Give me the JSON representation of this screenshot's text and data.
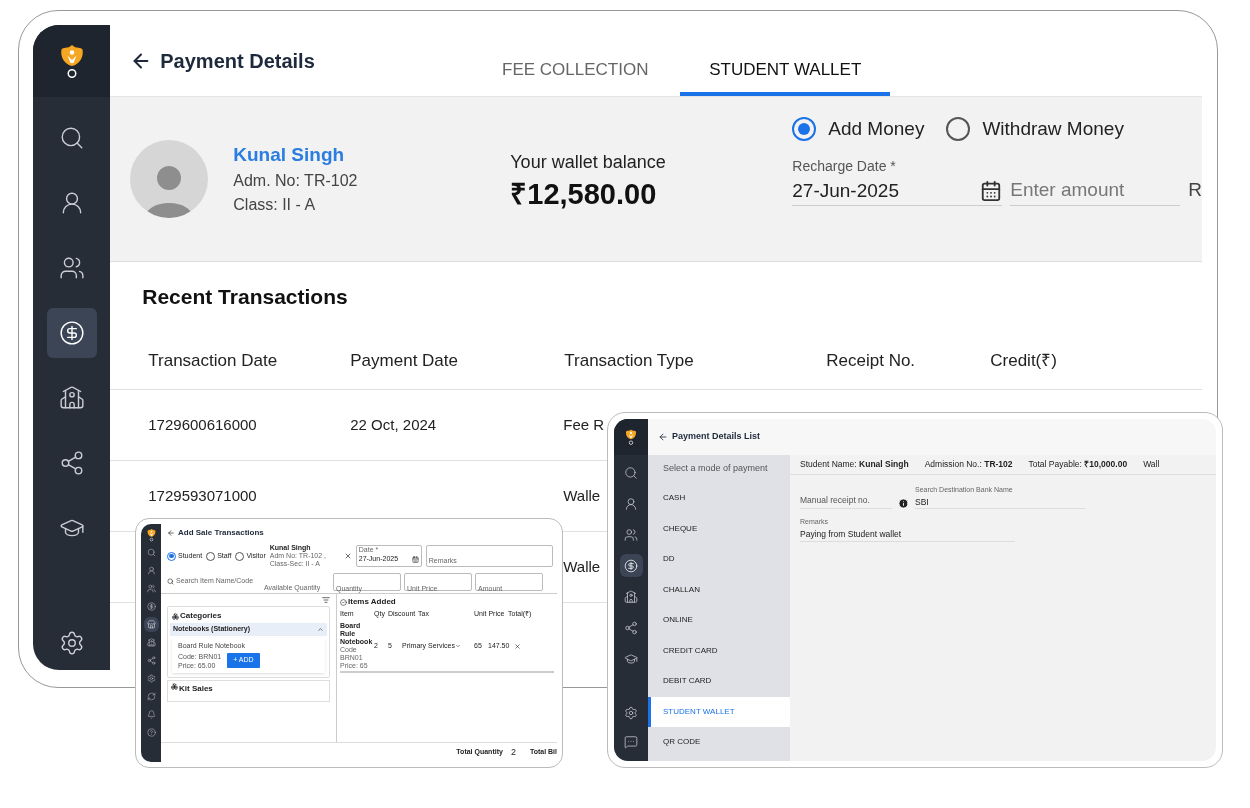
{
  "main": {
    "sidebar": {
      "items": [
        {
          "kind": "search",
          "selected": false
        },
        {
          "kind": "student",
          "selected": false
        },
        {
          "kind": "users",
          "selected": false
        },
        {
          "kind": "fees",
          "selected": true
        },
        {
          "kind": "school",
          "selected": false
        },
        {
          "kind": "network",
          "selected": false
        },
        {
          "kind": "academics",
          "selected": false
        },
        {
          "kind": "settings",
          "selected": false
        }
      ]
    },
    "title": "Payment Details",
    "tabs": [
      {
        "label": "FEE COLLECTION",
        "selected": false
      },
      {
        "label": "STUDENT WALLET",
        "selected": true
      }
    ],
    "student": {
      "name": "Kunal Singh",
      "admission": "Adm. No: TR-102",
      "class": "Class: II - A"
    },
    "wallet": {
      "label": "Your wallet balance",
      "amount": "₹12,580.00"
    },
    "modes": [
      {
        "label": "Add Money",
        "selected": true
      },
      {
        "label": "Withdraw Money",
        "selected": false
      }
    ],
    "recharge_date": {
      "label": "Recharge Date *",
      "value": "27-Jun-2025"
    },
    "amount": {
      "placeholder": "Enter amount"
    },
    "field_3": {
      "value": "R"
    },
    "transactions": {
      "title": "Recent Transactions",
      "columns": [
        "Transaction Date",
        "Payment Date",
        "Transaction Type",
        "Receipt No.",
        "Credit(₹)"
      ],
      "rows": [
        {
          "transaction_date": "1729600616000",
          "payment_date": "22 Oct, 2024",
          "transaction_type": "Fee R"
        },
        {
          "transaction_date": "1729593071000",
          "transaction_type": "Walle"
        },
        {
          "transaction_type": "Walle"
        }
      ]
    }
  },
  "sale_window": {
    "sidebar": {
      "items": [
        {
          "kind": "search",
          "selected": false
        },
        {
          "kind": "student",
          "selected": false
        },
        {
          "kind": "users",
          "selected": false
        },
        {
          "kind": "fees",
          "selected": false
        },
        {
          "kind": "store",
          "selected": true
        },
        {
          "kind": "school",
          "selected": false
        },
        {
          "kind": "network",
          "selected": false
        },
        {
          "kind": "settings",
          "selected": false
        },
        {
          "kind": "refresh",
          "selected": false
        },
        {
          "kind": "notifications",
          "selected": false
        },
        {
          "kind": "help",
          "selected": false
        }
      ]
    },
    "title": "Add Sale Transactions",
    "buyer_types": [
      {
        "label": "Student",
        "selected": true
      },
      {
        "label": "Staff",
        "selected": false
      },
      {
        "label": "Visitor",
        "selected": false
      }
    ],
    "buyer": {
      "name": "Kunal Singh",
      "details": "Adm No: TR-102 , Class-Sec: II - A"
    },
    "date": {
      "label": "Date *",
      "value": "27-Jun-2025"
    },
    "remarks": {
      "label": "Remarks"
    },
    "search": {
      "placeholder": "Search Item Name/Code"
    },
    "fields": [
      "Available Quantity",
      "Quantity",
      "Unit Price",
      "Amount"
    ],
    "categories": {
      "title": "Categories",
      "group": "Notebooks (Stationery)",
      "item": {
        "name": "Board Rule Notebook",
        "code": "Code: BRN01",
        "price": "Price: 65.00",
        "button": "+ ADD"
      }
    },
    "kit_sales": "Kit Sales",
    "items_added": {
      "title": "Items Added",
      "columns": [
        "Item",
        "Qty",
        "Discount",
        "Tax",
        "Unit Price",
        "Total(₹)"
      ],
      "rows": [
        {
          "item": "Board Rule Notebook",
          "code": "Code BRN01",
          "price": "Price: 65",
          "qty": "2",
          "discount": "5",
          "tax": "Primary Services",
          "unit_price": "65",
          "total": "147.50"
        }
      ]
    },
    "footer": {
      "quantity_label": "Total Quantity",
      "quantity": "2",
      "bill_label": "Total Bil"
    }
  },
  "payment_window": {
    "sidebar": {
      "items": [
        {
          "kind": "search",
          "selected": false
        },
        {
          "kind": "student",
          "selected": false
        },
        {
          "kind": "users",
          "selected": false
        },
        {
          "kind": "fees",
          "selected": true
        },
        {
          "kind": "school",
          "selected": false
        },
        {
          "kind": "network",
          "selected": false
        },
        {
          "kind": "academics",
          "selected": false
        },
        {
          "kind": "settings",
          "selected": false
        },
        {
          "kind": "chat",
          "selected": false
        }
      ]
    },
    "title": "Payment Details List",
    "modes_label": "Select a mode of payment",
    "modes": [
      {
        "label": "CASH",
        "selected": false
      },
      {
        "label": "CHEQUE",
        "selected": false
      },
      {
        "label": "DD",
        "selected": false
      },
      {
        "label": "CHALLAN",
        "selected": false
      },
      {
        "label": "ONLINE",
        "selected": false
      },
      {
        "label": "CREDIT CARD",
        "selected": false
      },
      {
        "label": "DEBIT CARD",
        "selected": false
      },
      {
        "label": "STUDENT WALLET",
        "selected": true
      },
      {
        "label": "QR CODE",
        "selected": false
      }
    ],
    "info": [
      "Student Name: **Kunal Singh**",
      "Admission No.: **TR-102**",
      "Total Payable: **₹10,000.00**",
      "Wall"
    ],
    "receipt": {
      "placeholder": "Manual receipt no."
    },
    "bank": {
      "label": "Search Destination Bank Name",
      "value": "SBI"
    },
    "remarks": {
      "label": "Remarks",
      "value": "Paying from Student wallet"
    }
  }
}
